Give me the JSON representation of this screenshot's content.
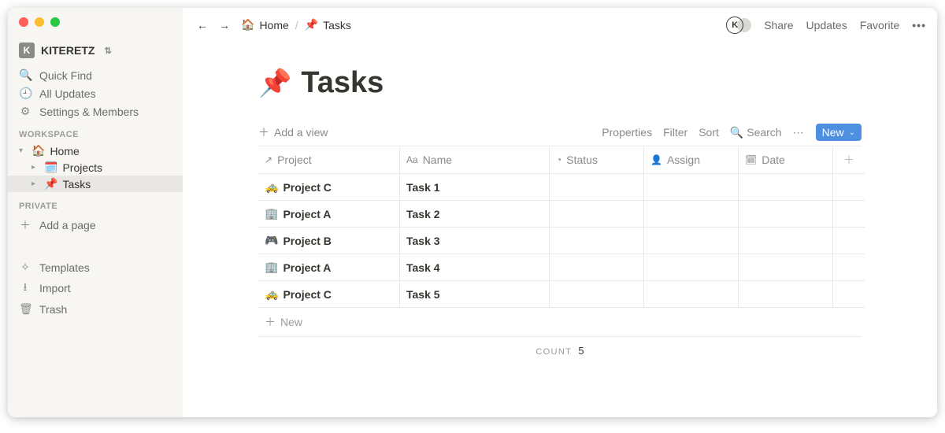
{
  "workspace": {
    "badge": "K",
    "name": "KITERETZ"
  },
  "sidebar": {
    "quick_find": "Quick Find",
    "all_updates": "All Updates",
    "settings": "Settings & Members",
    "section_workspace": "WORKSPACE",
    "section_private": "PRIVATE",
    "tree": {
      "home": {
        "emoji": "🏠",
        "label": "Home"
      },
      "projects": {
        "emoji": "🗓️",
        "label": "Projects"
      },
      "tasks": {
        "emoji": "📌",
        "label": "Tasks"
      }
    },
    "add_page": "Add a page",
    "templates": "Templates",
    "import": "Import",
    "trash": "Trash"
  },
  "breadcrumbs": {
    "home": {
      "emoji": "🏠",
      "label": "Home"
    },
    "current": {
      "emoji": "📌",
      "label": "Tasks"
    }
  },
  "topbar": {
    "avatar_initial": "K",
    "share": "Share",
    "updates": "Updates",
    "favorite": "Favorite"
  },
  "page": {
    "emoji": "📌",
    "title": "Tasks"
  },
  "viewbar": {
    "add_view": "Add a view",
    "properties": "Properties",
    "filter": "Filter",
    "sort": "Sort",
    "search": "Search",
    "new": "New"
  },
  "table": {
    "columns": {
      "project": "Project",
      "name": "Name",
      "status": "Status",
      "assign": "Assign",
      "date": "Date"
    },
    "rows": [
      {
        "project_emoji": "🚕",
        "project": "Project C",
        "name": "Task 1"
      },
      {
        "project_emoji": "🏢",
        "project": "Project A",
        "name": "Task 2"
      },
      {
        "project_emoji": "🎮",
        "project": "Project B",
        "name": "Task 3"
      },
      {
        "project_emoji": "🏢",
        "project": "Project A",
        "name": "Task 4"
      },
      {
        "project_emoji": "🚕",
        "project": "Project C",
        "name": "Task 5"
      }
    ],
    "new_row": "New",
    "count_label": "COUNT",
    "count_value": "5"
  }
}
